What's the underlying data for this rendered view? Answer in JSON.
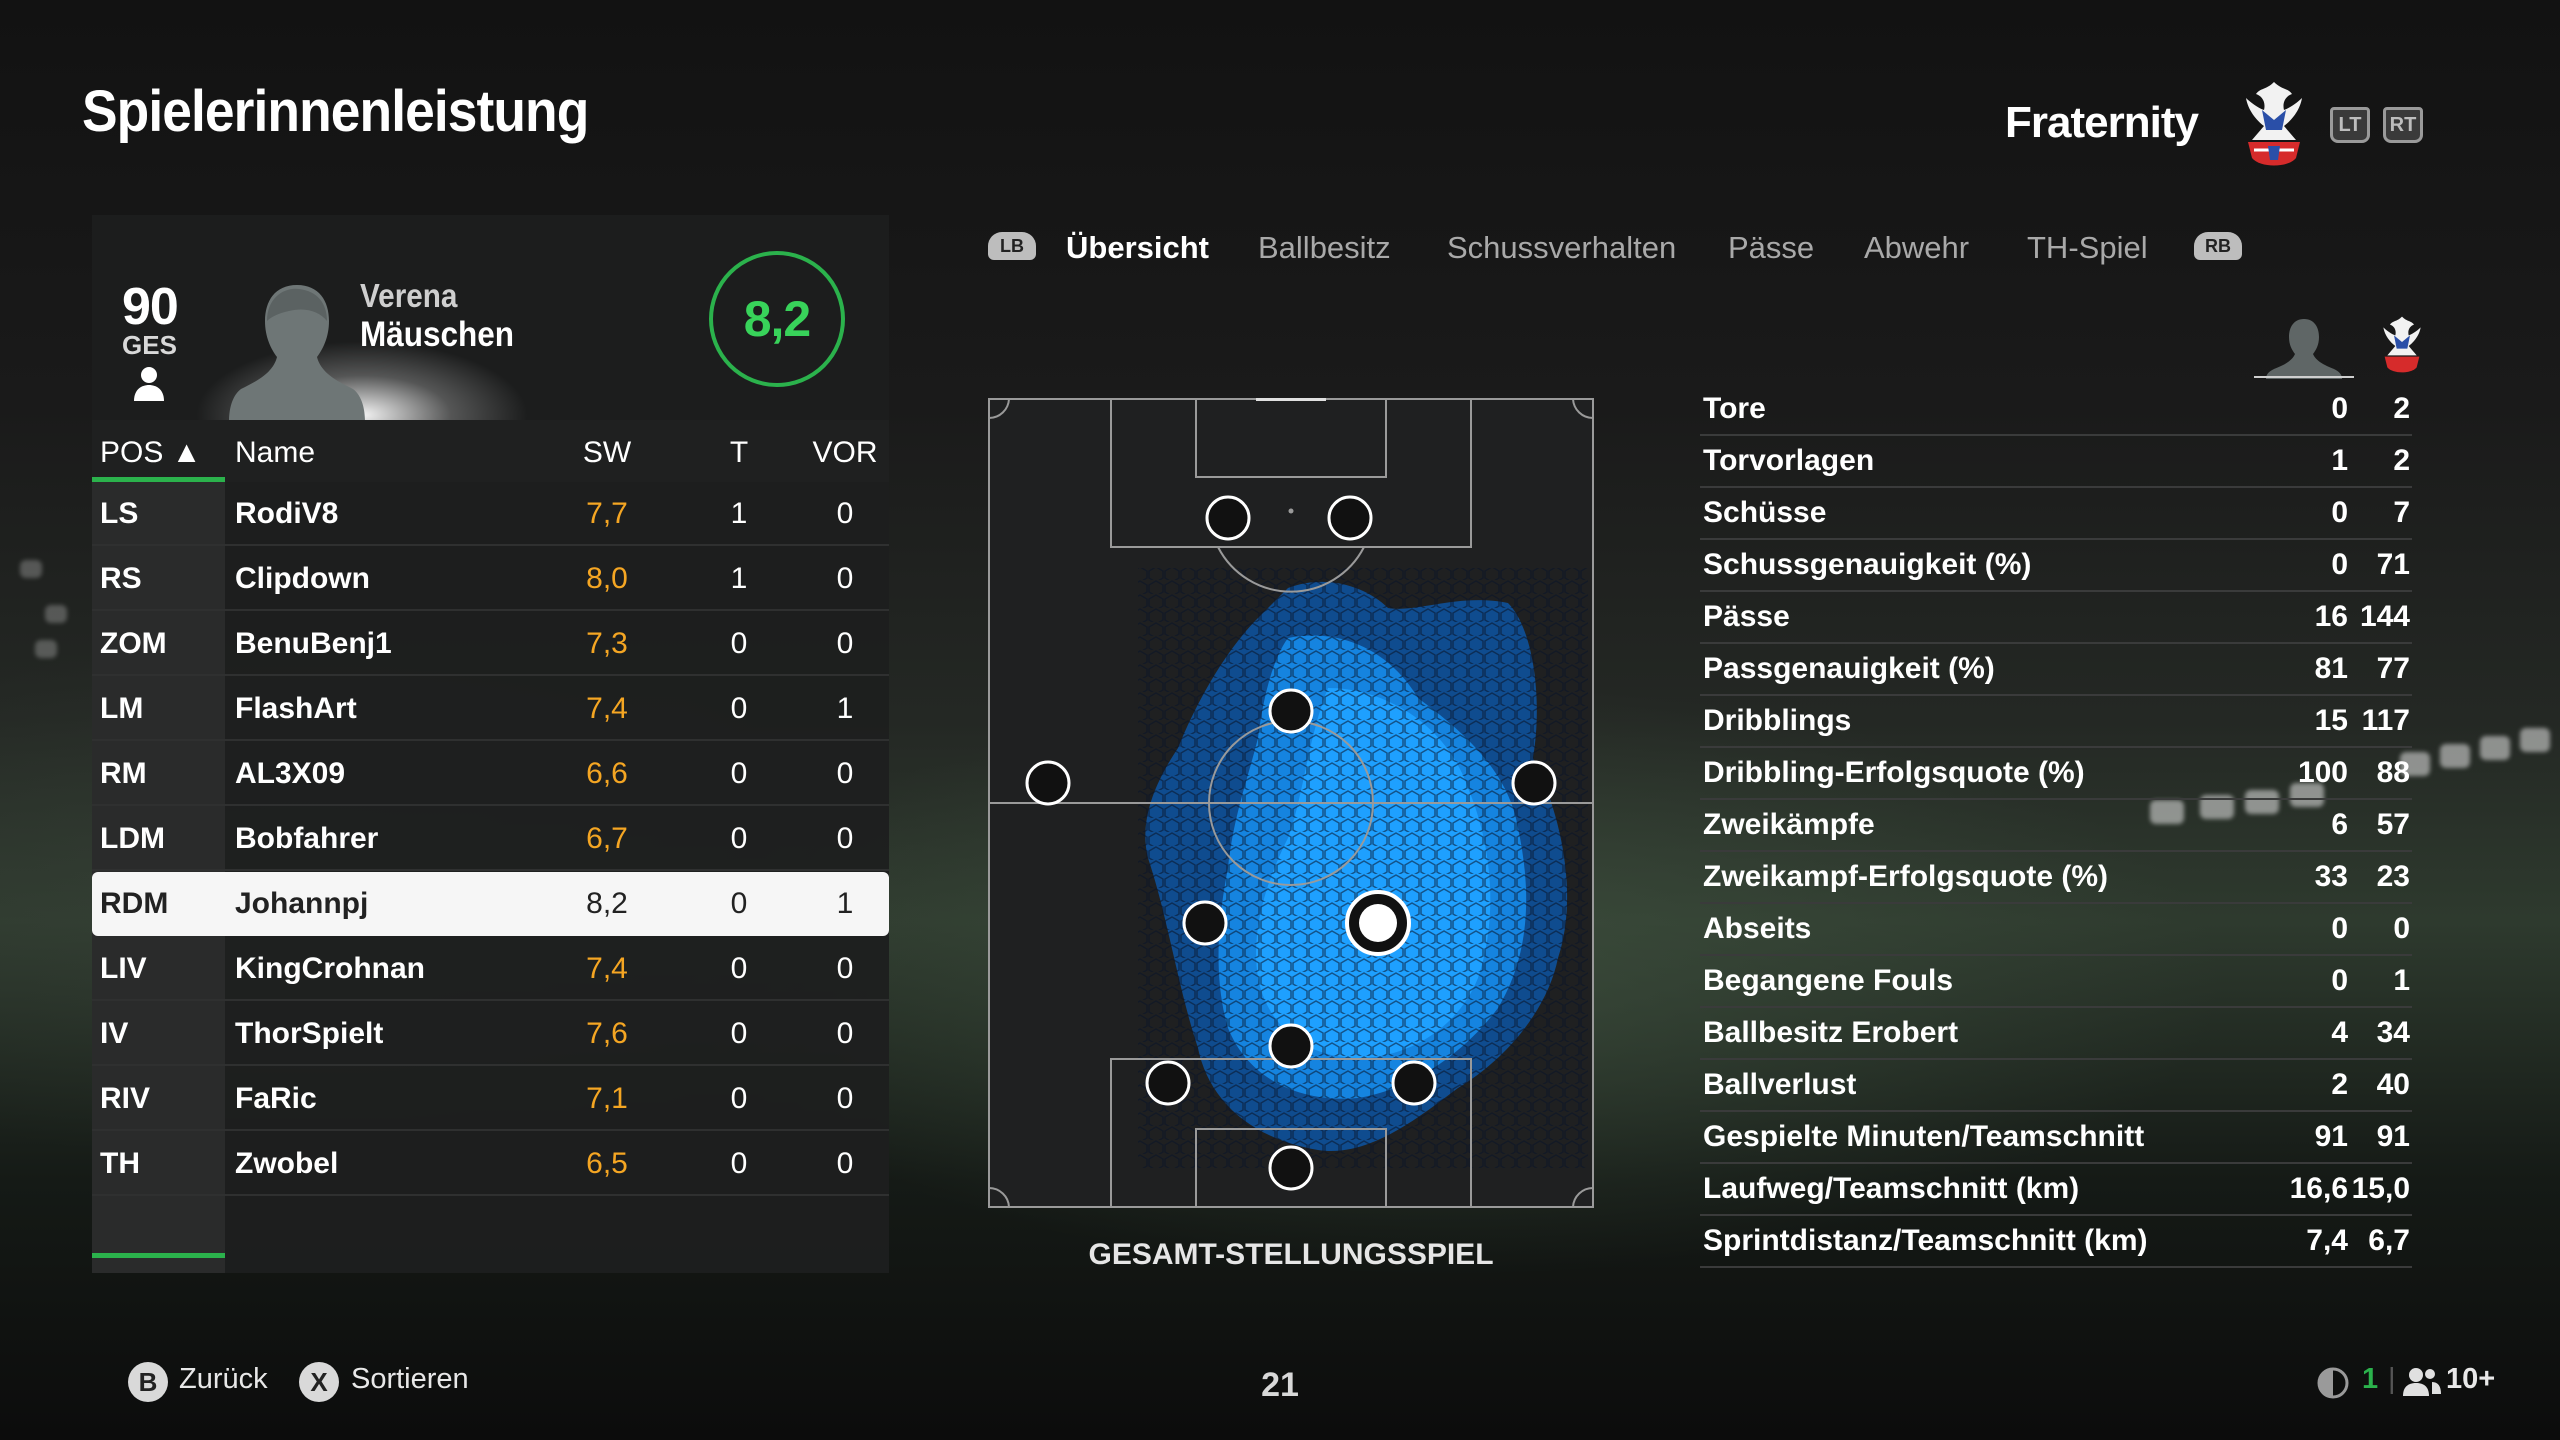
{
  "page": {
    "title": "Spielerinnenleistung",
    "team_name": "Fraternity",
    "trigger_left": "LT",
    "trigger_right": "RT"
  },
  "player": {
    "overall": "90",
    "overall_label": "GES",
    "first_name": "Verena",
    "last_name": "Mäuschen",
    "rating": "8,2"
  },
  "table": {
    "headers": {
      "pos": "POS ▲",
      "name": "Name",
      "sw": "SW",
      "t": "T",
      "vor": "VOR"
    },
    "rows": [
      {
        "pos": "LS",
        "name": "RodiV8",
        "sw": "7,7",
        "t": "1",
        "vor": "0"
      },
      {
        "pos": "RS",
        "name": "Clipdown",
        "sw": "8,0",
        "t": "1",
        "vor": "0"
      },
      {
        "pos": "ZOM",
        "name": "BenuBenj1",
        "sw": "7,3",
        "t": "0",
        "vor": "0"
      },
      {
        "pos": "LM",
        "name": "FlashArt",
        "sw": "7,4",
        "t": "0",
        "vor": "1"
      },
      {
        "pos": "RM",
        "name": "AL3X09",
        "sw": "6,6",
        "t": "0",
        "vor": "0"
      },
      {
        "pos": "LDM",
        "name": "Bobfahrer",
        "sw": "6,7",
        "t": "0",
        "vor": "0"
      },
      {
        "pos": "RDM",
        "name": "Johannpj",
        "sw": "8,2",
        "t": "0",
        "vor": "1"
      },
      {
        "pos": "LIV",
        "name": "KingCrohnan",
        "sw": "7,4",
        "t": "0",
        "vor": "0"
      },
      {
        "pos": "IV",
        "name": "ThorSpielt",
        "sw": "7,6",
        "t": "0",
        "vor": "0"
      },
      {
        "pos": "RIV",
        "name": "FaRic",
        "sw": "7,1",
        "t": "0",
        "vor": "0"
      },
      {
        "pos": "TH",
        "name": "Zwobel",
        "sw": "6,5",
        "t": "0",
        "vor": "0"
      }
    ]
  },
  "tabs": {
    "lb": "LB",
    "rb": "RB",
    "items": [
      "Übersicht",
      "Ballbesitz",
      "Schussverhalten",
      "Pässe",
      "Abwehr",
      "TH-Spiel"
    ],
    "active": "Übersicht"
  },
  "pitch": {
    "caption": "GESAMT-STELLUNGSSPIEL",
    "heat_color": "#1ea0ff"
  },
  "stats": [
    {
      "label": "Tore",
      "player": "0",
      "team": "2"
    },
    {
      "label": "Torvorlagen",
      "player": "1",
      "team": "2"
    },
    {
      "label": "Schüsse",
      "player": "0",
      "team": "7"
    },
    {
      "label": "Schussgenauigkeit (%)",
      "player": "0",
      "team": "71"
    },
    {
      "label": "Pässe",
      "player": "16",
      "team": "144"
    },
    {
      "label": "Passgenauigkeit (%)",
      "player": "81",
      "team": "77"
    },
    {
      "label": "Dribblings",
      "player": "15",
      "team": "117"
    },
    {
      "label": "Dribbling-Erfolgsquote (%)",
      "player": "100",
      "team": "88"
    },
    {
      "label": "Zweikämpfe",
      "player": "6",
      "team": "57"
    },
    {
      "label": "Zweikampf-Erfolgsquote (%)",
      "player": "33",
      "team": "23"
    },
    {
      "label": "Abseits",
      "player": "0",
      "team": "0"
    },
    {
      "label": "Begangene Fouls",
      "player": "0",
      "team": "1"
    },
    {
      "label": "Ballbesitz Erobert",
      "player": "4",
      "team": "34"
    },
    {
      "label": "Ballverlust",
      "player": "2",
      "team": "40"
    },
    {
      "label": "Gespielte Minuten/Teamschnitt",
      "player": "91",
      "team": "91"
    },
    {
      "label": "Laufweg/Teamschnitt (km)",
      "player": "16,6",
      "team": "15,0"
    },
    {
      "label": "Sprintdistanz/Teamschnitt (km)",
      "player": "7,4",
      "team": "6,7"
    }
  ],
  "footer": {
    "back_button": "B",
    "back_label": "Zurück",
    "sort_button": "X",
    "sort_label": "Sortieren",
    "page_number": "21",
    "status_count": "1",
    "players_count": "10+"
  },
  "colors": {
    "accent_green": "#2bb24c",
    "rating_orange": "#f5a623",
    "heat_blue": "#1ea0ff"
  }
}
